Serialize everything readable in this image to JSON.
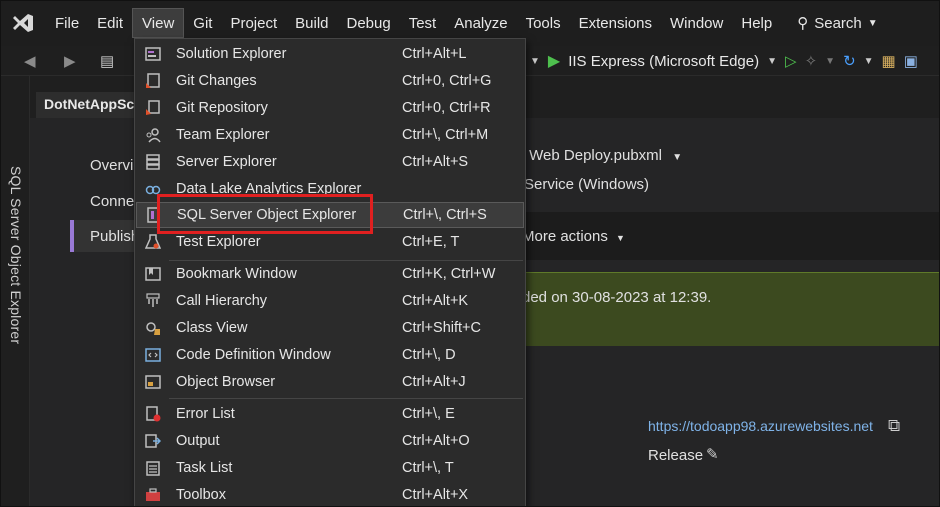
{
  "menubar": {
    "items": [
      "File",
      "Edit",
      "View",
      "Git",
      "Project",
      "Build",
      "Debug",
      "Test",
      "Analyze",
      "Tools",
      "Extensions",
      "Window",
      "Help"
    ],
    "active": "View",
    "search_label": "Search"
  },
  "toolbar": {
    "run_target": "IIS Express (Microsoft Edge)"
  },
  "side_tab": {
    "label": "SQL Server Object Explorer"
  },
  "doc_tab": {
    "label": "DotNetAppSc"
  },
  "left_nav": {
    "overview": "Overvi",
    "connected": "Conne",
    "publish": "Publish"
  },
  "publish_page": {
    "profile": "- Web Deploy.pubxml",
    "target": "Service (Windows)",
    "more_actions": "More actions",
    "banner_text": "ded on 30-08-2023 at 12:39.",
    "site_url": "https://todoapp98.azurewebsites.net",
    "configuration": "Release"
  },
  "view_menu": {
    "items": [
      {
        "label": "Solution Explorer",
        "shortcut": "Ctrl+Alt+L",
        "icon": "solution-explorer-icon"
      },
      {
        "label": "Git Changes",
        "shortcut": "Ctrl+0, Ctrl+G",
        "icon": "git-changes-icon"
      },
      {
        "label": "Git Repository",
        "shortcut": "Ctrl+0, Ctrl+R",
        "icon": "git-repository-icon"
      },
      {
        "label": "Team Explorer",
        "shortcut": "Ctrl+\\, Ctrl+M",
        "icon": "team-explorer-icon"
      },
      {
        "label": "Server Explorer",
        "shortcut": "Ctrl+Alt+S",
        "icon": "server-explorer-icon"
      },
      {
        "label": "Data Lake Analytics Explorer",
        "shortcut": "",
        "icon": "data-lake-icon"
      },
      {
        "label": "SQL Server Object Explorer",
        "shortcut": "Ctrl+\\, Ctrl+S",
        "icon": "sql-server-icon"
      },
      {
        "label": "Test Explorer",
        "shortcut": "Ctrl+E, T",
        "icon": "test-explorer-icon"
      },
      {
        "label": "Bookmark Window",
        "shortcut": "Ctrl+K, Ctrl+W",
        "icon": "bookmark-icon"
      },
      {
        "label": "Call Hierarchy",
        "shortcut": "Ctrl+Alt+K",
        "icon": "call-hierarchy-icon"
      },
      {
        "label": "Class View",
        "shortcut": "Ctrl+Shift+C",
        "icon": "class-view-icon"
      },
      {
        "label": "Code Definition Window",
        "shortcut": "Ctrl+\\, D",
        "icon": "code-definition-icon"
      },
      {
        "label": "Object Browser",
        "shortcut": "Ctrl+Alt+J",
        "icon": "object-browser-icon"
      },
      {
        "label": "Error List",
        "shortcut": "Ctrl+\\, E",
        "icon": "error-list-icon"
      },
      {
        "label": "Output",
        "shortcut": "Ctrl+Alt+O",
        "icon": "output-icon"
      },
      {
        "label": "Task List",
        "shortcut": "Ctrl+\\, T",
        "icon": "task-list-icon"
      },
      {
        "label": "Toolbox",
        "shortcut": "Ctrl+Alt+X",
        "icon": "toolbox-icon"
      }
    ],
    "highlighted": "SQL Server Object Explorer"
  },
  "colors": {
    "highlight_box": "#e02020",
    "banner": "#3c4a1f",
    "accent": "#9a7ad6"
  }
}
